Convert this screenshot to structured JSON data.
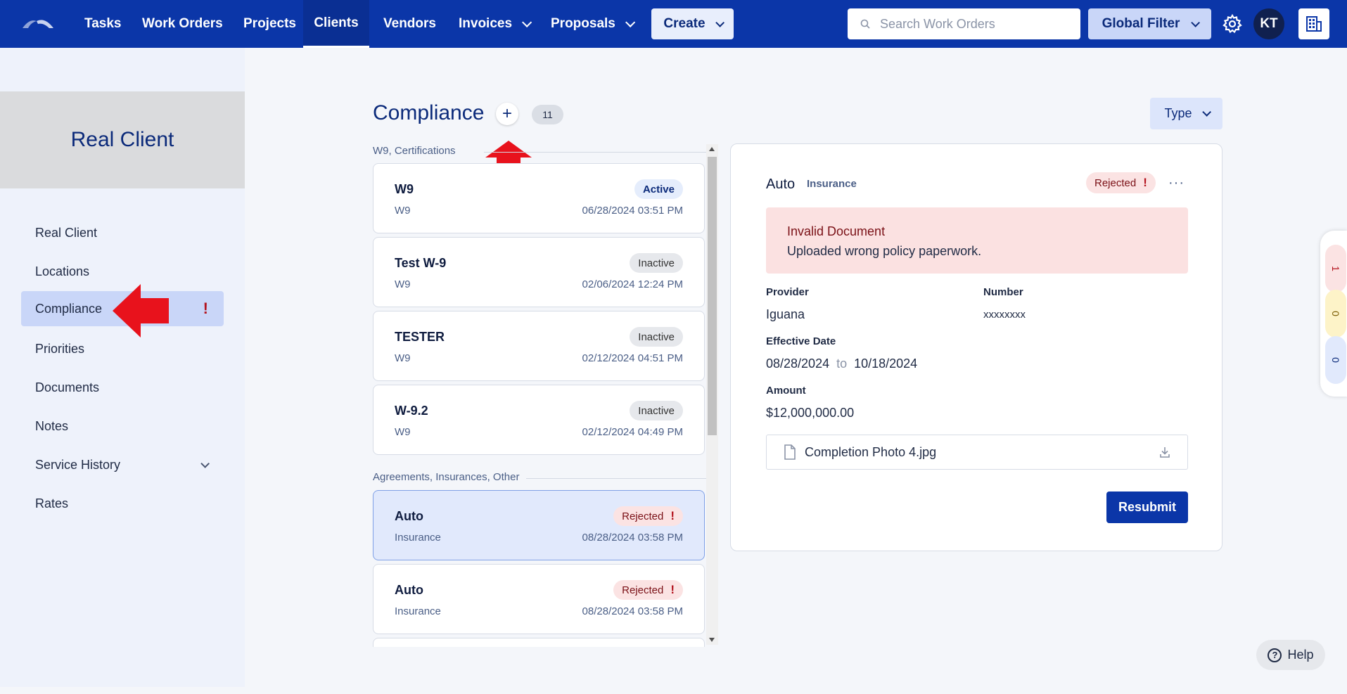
{
  "nav": {
    "items": [
      {
        "label": "Tasks"
      },
      {
        "label": "Work Orders"
      },
      {
        "label": "Projects"
      },
      {
        "label": "Clients"
      },
      {
        "label": "Vendors"
      },
      {
        "label": "Invoices"
      },
      {
        "label": "Proposals"
      }
    ],
    "create_label": "Create",
    "search_placeholder": "Search Work Orders",
    "global_filter_label": "Global Filter",
    "avatar_initials": "KT"
  },
  "sidebar": {
    "client_name": "Real Client",
    "items": [
      {
        "label": "Real Client"
      },
      {
        "label": "Locations"
      },
      {
        "label": "Compliance"
      },
      {
        "label": "Priorities"
      },
      {
        "label": "Documents"
      },
      {
        "label": "Notes"
      },
      {
        "label": "Service History"
      },
      {
        "label": "Rates"
      }
    ],
    "compliance_alert": "!"
  },
  "main": {
    "title": "Compliance",
    "plus_label": "+",
    "count": "11",
    "type_filter_label": "Type",
    "groups": [
      {
        "label": "W9, Certifications"
      },
      {
        "label": "Agreements, Insurances, Other"
      }
    ],
    "cards": [
      {
        "title": "W9",
        "subtitle": "W9",
        "status": "Active",
        "date": "06/28/2024 03:51 PM"
      },
      {
        "title": "Test W-9",
        "subtitle": "W9",
        "status": "Inactive",
        "date": "02/06/2024 12:24 PM"
      },
      {
        "title": "TESTER",
        "subtitle": "W9",
        "status": "Inactive",
        "date": "02/12/2024 04:51 PM"
      },
      {
        "title": "W-9.2",
        "subtitle": "W9",
        "status": "Inactive",
        "date": "02/12/2024 04:49 PM"
      },
      {
        "title": "Auto",
        "subtitle": "Insurance",
        "status": "Rejected",
        "date": "08/28/2024 03:58 PM"
      },
      {
        "title": "Auto",
        "subtitle": "Insurance",
        "status": "Rejected",
        "date": "08/28/2024 03:58 PM"
      }
    ],
    "rejected_mark": "!"
  },
  "detail": {
    "title": "Auto",
    "type": "Insurance",
    "status": "Rejected",
    "status_mark": "!",
    "more": "···",
    "alert_title": "Invalid Document",
    "alert_message": "Uploaded wrong policy paperwork.",
    "provider_label": "Provider",
    "provider_value": "Iguana",
    "number_label": "Number",
    "number_value": "xxxxxxxx",
    "effective_label": "Effective Date",
    "effective_from": "08/28/2024",
    "effective_to_word": "to",
    "effective_to": "10/18/2024",
    "amount_label": "Amount",
    "amount_value": "$12,000,000.00",
    "file_name": "Completion Photo 4.jpg",
    "resubmit_label": "Resubmit"
  },
  "float_counts": {
    "red": "1",
    "yellow": "0",
    "blue": "0"
  },
  "help_label": "Help",
  "colors": {
    "nav_bg": "#0b36a8",
    "accent": "#0b2a7a",
    "rejected_bg": "#fbe3e3",
    "annotation_arrow": "#e8121c"
  }
}
